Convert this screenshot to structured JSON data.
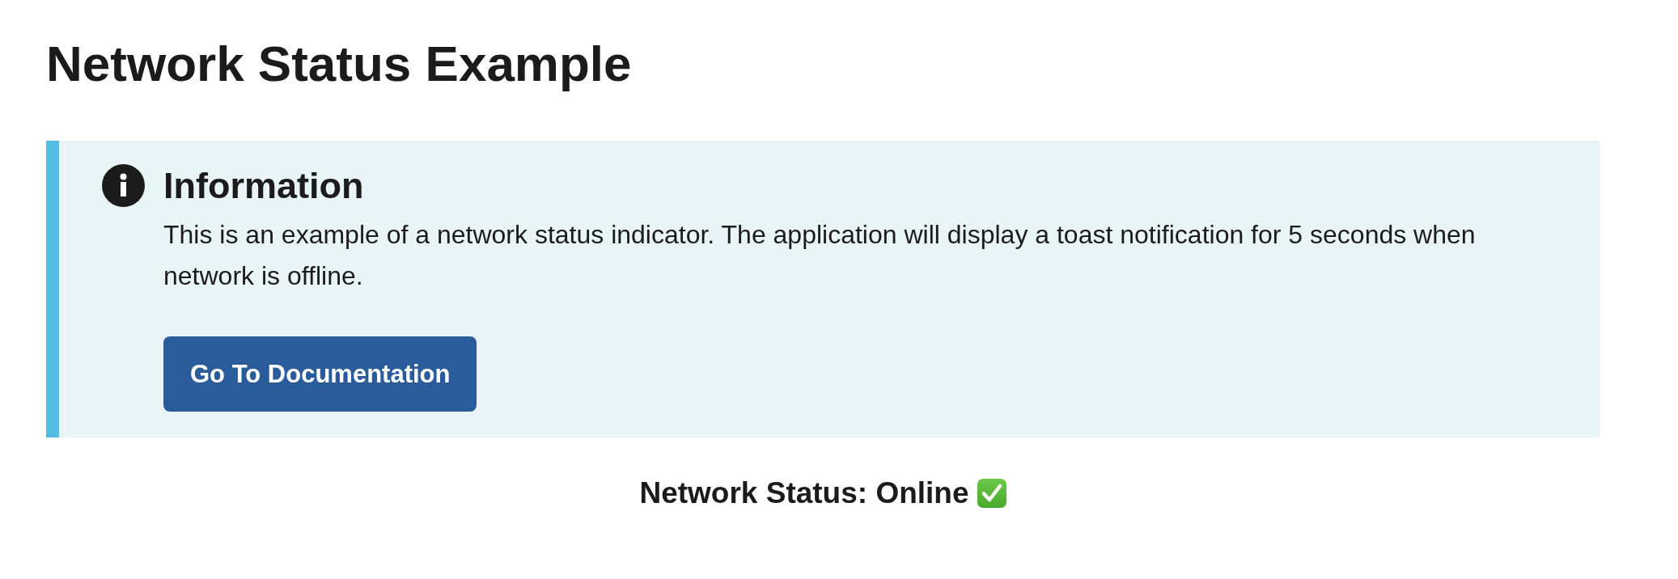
{
  "page": {
    "title": "Network Status Example"
  },
  "alert": {
    "kind": "info",
    "heading": "Information",
    "message": "This is an example of a network status indicator. The application will display a toast notification for 5 seconds when network is offline.",
    "button": {
      "label": "Go To Documentation"
    }
  },
  "status": {
    "label": "Network Status: Online",
    "online": true
  }
}
